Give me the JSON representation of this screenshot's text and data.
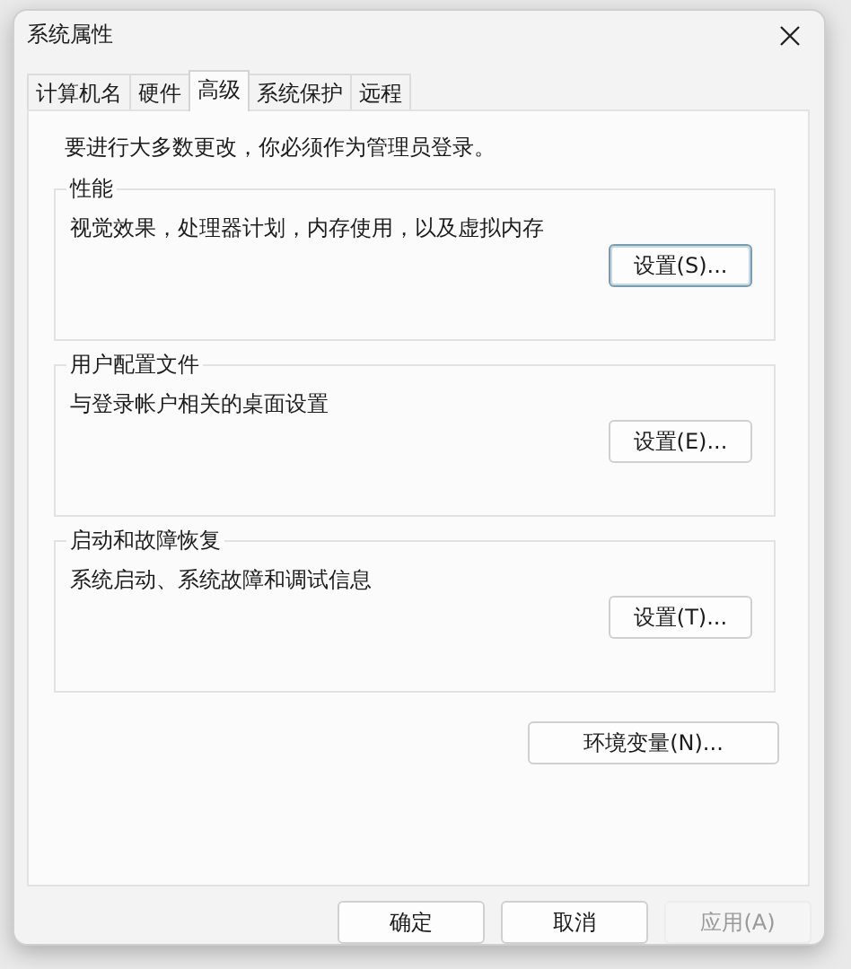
{
  "window": {
    "title": "系统属性"
  },
  "tabs": [
    {
      "label": "计算机名",
      "selected": false
    },
    {
      "label": "硬件",
      "selected": false
    },
    {
      "label": "高级",
      "selected": true
    },
    {
      "label": "系统保护",
      "selected": false
    },
    {
      "label": "远程",
      "selected": false
    }
  ],
  "notice": "要进行大多数更改，你必须作为管理员登录。",
  "groups": [
    {
      "title": "性能",
      "description": "视觉效果，处理器计划，内存使用，以及虚拟内存",
      "button": "设置(S)...",
      "focused": true
    },
    {
      "title": "用户配置文件",
      "description": "与登录帐户相关的桌面设置",
      "button": "设置(E)...",
      "focused": false
    },
    {
      "title": "启动和故障恢复",
      "description": "系统启动、系统故障和调试信息",
      "button": "设置(T)...",
      "focused": false
    }
  ],
  "env_button": "环境变量(N)...",
  "buttons": [
    {
      "label": "确定",
      "disabled": false
    },
    {
      "label": "取消",
      "disabled": false
    },
    {
      "label": "应用(A)",
      "disabled": true
    }
  ]
}
